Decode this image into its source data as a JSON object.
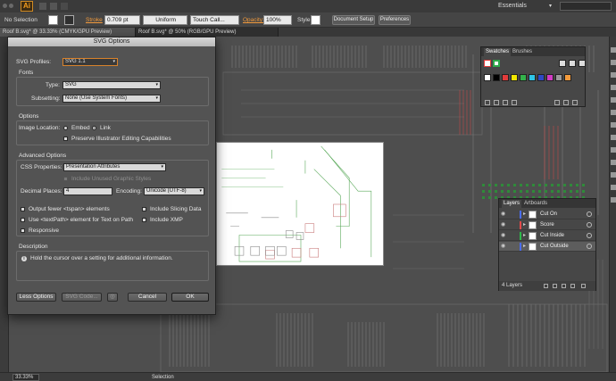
{
  "app": {
    "logo": "Ai",
    "workspace": "Essentials"
  },
  "controlbar": {
    "selection": "No Selection",
    "stroke_label": "Stroke",
    "stroke_weight": "0.709 pt",
    "profile": "Uniform",
    "brush": "Touch Call...",
    "opacity_label": "Opacity:",
    "opacity_value": "100%",
    "style_label": "Style:",
    "document_setup": "Document Setup",
    "preferences": "Preferences"
  },
  "tabs": [
    {
      "label": "Roof B.svg* @ 33.33% (CMYK/GPU Preview)"
    },
    {
      "label": "Roof B.svg* @ 50% (RGB/GPU Preview)"
    }
  ],
  "dialog": {
    "title": "SVG Options",
    "svg_profiles_label": "SVG Profiles:",
    "svg_profiles_value": "SVG 1.1",
    "fonts_section": "Fonts",
    "type_label": "Type:",
    "type_value": "SVG",
    "subsetting_label": "Subsetting:",
    "subsetting_value": "None (Use System Fonts)",
    "options_section": "Options",
    "image_location_label": "Image Location:",
    "embed_label": "Embed",
    "link_label": "Link",
    "preserve_label": "Preserve Illustrator Editing Capabilities",
    "advanced_section": "Advanced Options",
    "css_label": "CSS Properties:",
    "css_value": "Presentation Attributes",
    "include_unused_label": "Include Unused Graphic Styles",
    "decimal_label": "Decimal Places:",
    "decimal_value": "4",
    "encoding_label": "Encoding:",
    "encoding_value": "Unicode (UTF-8)",
    "output_fewer_label": "Output fewer <tspan> elements",
    "include_slicing_label": "Include Slicing Data",
    "use_textpath_label": "Use <textPath> element for Text on Path",
    "include_xmp_label": "Include XMP",
    "responsive_label": "Responsive",
    "description_section": "Description",
    "description_text": "Hold the cursor over a setting for additional information.",
    "less_options": "Less Options",
    "svg_code": "SVG Code...",
    "cancel": "Cancel",
    "ok": "OK"
  },
  "swatches": {
    "tab_swatches": "Swatches",
    "tab_brushes": "Brushes",
    "colors": [
      "#ffffff",
      "#000000",
      "#e23b3b",
      "#f2e600",
      "#33b24a",
      "#2ec4e6",
      "#2e49c4",
      "#d23bc4",
      "#9a9a9a",
      "#f29a3c"
    ]
  },
  "layers": {
    "tab_layers": "Layers",
    "tab_artboards": "Artboards",
    "items": [
      {
        "name": "Cut On",
        "color": "#4a6cf0"
      },
      {
        "name": "Score",
        "color": "#e24a4a"
      },
      {
        "name": "Cut Inside",
        "color": "#2db84a"
      },
      {
        "name": "Cut Outside",
        "color": "#4a6cf0"
      }
    ],
    "count": "4 Layers"
  },
  "status": {
    "zoom": "33.33%",
    "mode": "Selection"
  }
}
